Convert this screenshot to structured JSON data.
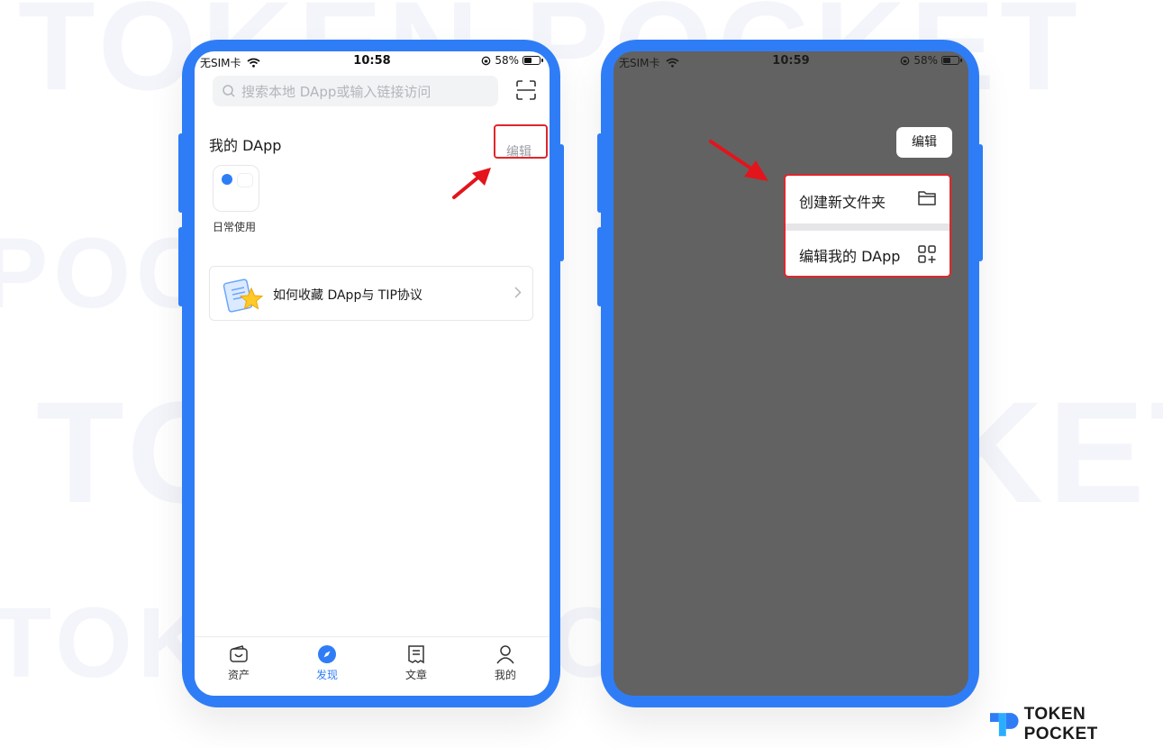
{
  "watermark": {
    "lines": [
      "TOKEN POCKET",
      "POCKET",
      "TOKEN POCKET",
      "TOKEN POCKET"
    ]
  },
  "colors": {
    "frame": "#2f7df6",
    "accent": "#2f7df6",
    "highlight": "#e0262b",
    "overlay": "#626262"
  },
  "left_phone": {
    "status": {
      "carrier": "无SIM卡",
      "time": "10:58",
      "battery": "58%",
      "battery_level": 0.58
    },
    "search": {
      "placeholder": "搜索本地 DApp或输入链接访问",
      "icon": "search-icon"
    },
    "scan_icon": "scan-icon",
    "section_title": "我的 DApp",
    "edit_label": "编辑",
    "folder": {
      "label": "日常使用"
    },
    "banner": {
      "text": "如何收藏 DApp与 TIP协议",
      "icon": "chevron-right-icon"
    },
    "tabs": [
      {
        "label": "资产",
        "icon": "wallet-icon",
        "active": false
      },
      {
        "label": "发现",
        "icon": "compass-icon",
        "active": true
      },
      {
        "label": "文章",
        "icon": "article-icon",
        "active": false
      },
      {
        "label": "我的",
        "icon": "user-icon",
        "active": false
      }
    ]
  },
  "right_phone": {
    "status": {
      "carrier": "无SIM卡",
      "time": "10:59",
      "battery": "58%",
      "battery_level": 0.58
    },
    "edit_label": "编辑",
    "menu": [
      {
        "label": "创建新文件夹",
        "icon": "folder-icon"
      },
      {
        "label": "编辑我的 DApp",
        "icon": "grid-add-icon"
      }
    ]
  },
  "brand": {
    "name": "TOKEN POCKET",
    "logo": "tokenpocket-logo"
  }
}
